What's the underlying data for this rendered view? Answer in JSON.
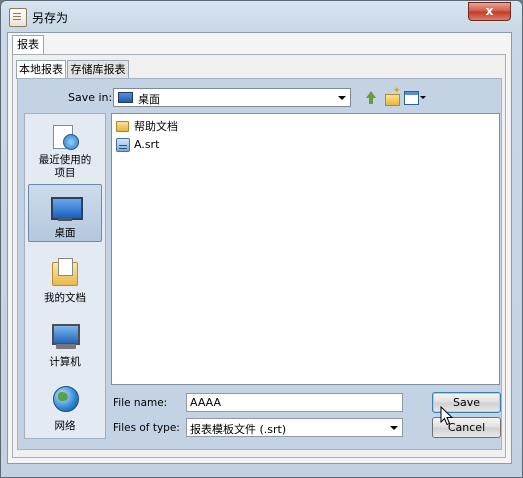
{
  "window": {
    "title": "另存为",
    "close_label": "x"
  },
  "outer_tab": {
    "label": "报表"
  },
  "inner_tabs": [
    {
      "label": "本地报表",
      "active": true
    },
    {
      "label": "存储库报表",
      "active": false
    }
  ],
  "toolbar": {
    "save_in_label": "Save in:",
    "save_in_value": "桌面",
    "icons": [
      "up-one-level-icon",
      "new-folder-icon",
      "view-menu-icon"
    ]
  },
  "places": [
    {
      "label": "最近使用的项目",
      "icon": "recent-items-icon",
      "selected": false
    },
    {
      "label": "桌面",
      "icon": "desktop-icon",
      "selected": true
    },
    {
      "label": "我的文档",
      "icon": "my-documents-icon",
      "selected": false
    },
    {
      "label": "计算机",
      "icon": "computer-icon",
      "selected": false
    },
    {
      "label": "网络",
      "icon": "network-icon",
      "selected": false
    }
  ],
  "files": [
    {
      "name": "帮助文档",
      "icon": "folder-icon"
    },
    {
      "name": "A.srt",
      "icon": "report-file-icon"
    }
  ],
  "form": {
    "file_name_label": "File name:",
    "file_name_value": "AAAA",
    "file_type_label": "Files of type:",
    "file_type_value": "报表模板文件 (.srt)"
  },
  "buttons": {
    "save": "Save",
    "cancel": "Cancel"
  },
  "colors": {
    "dialog_bg": "#c4d3e3",
    "default_button_border": "#3c7fb1",
    "close_button": "#c13a23"
  }
}
